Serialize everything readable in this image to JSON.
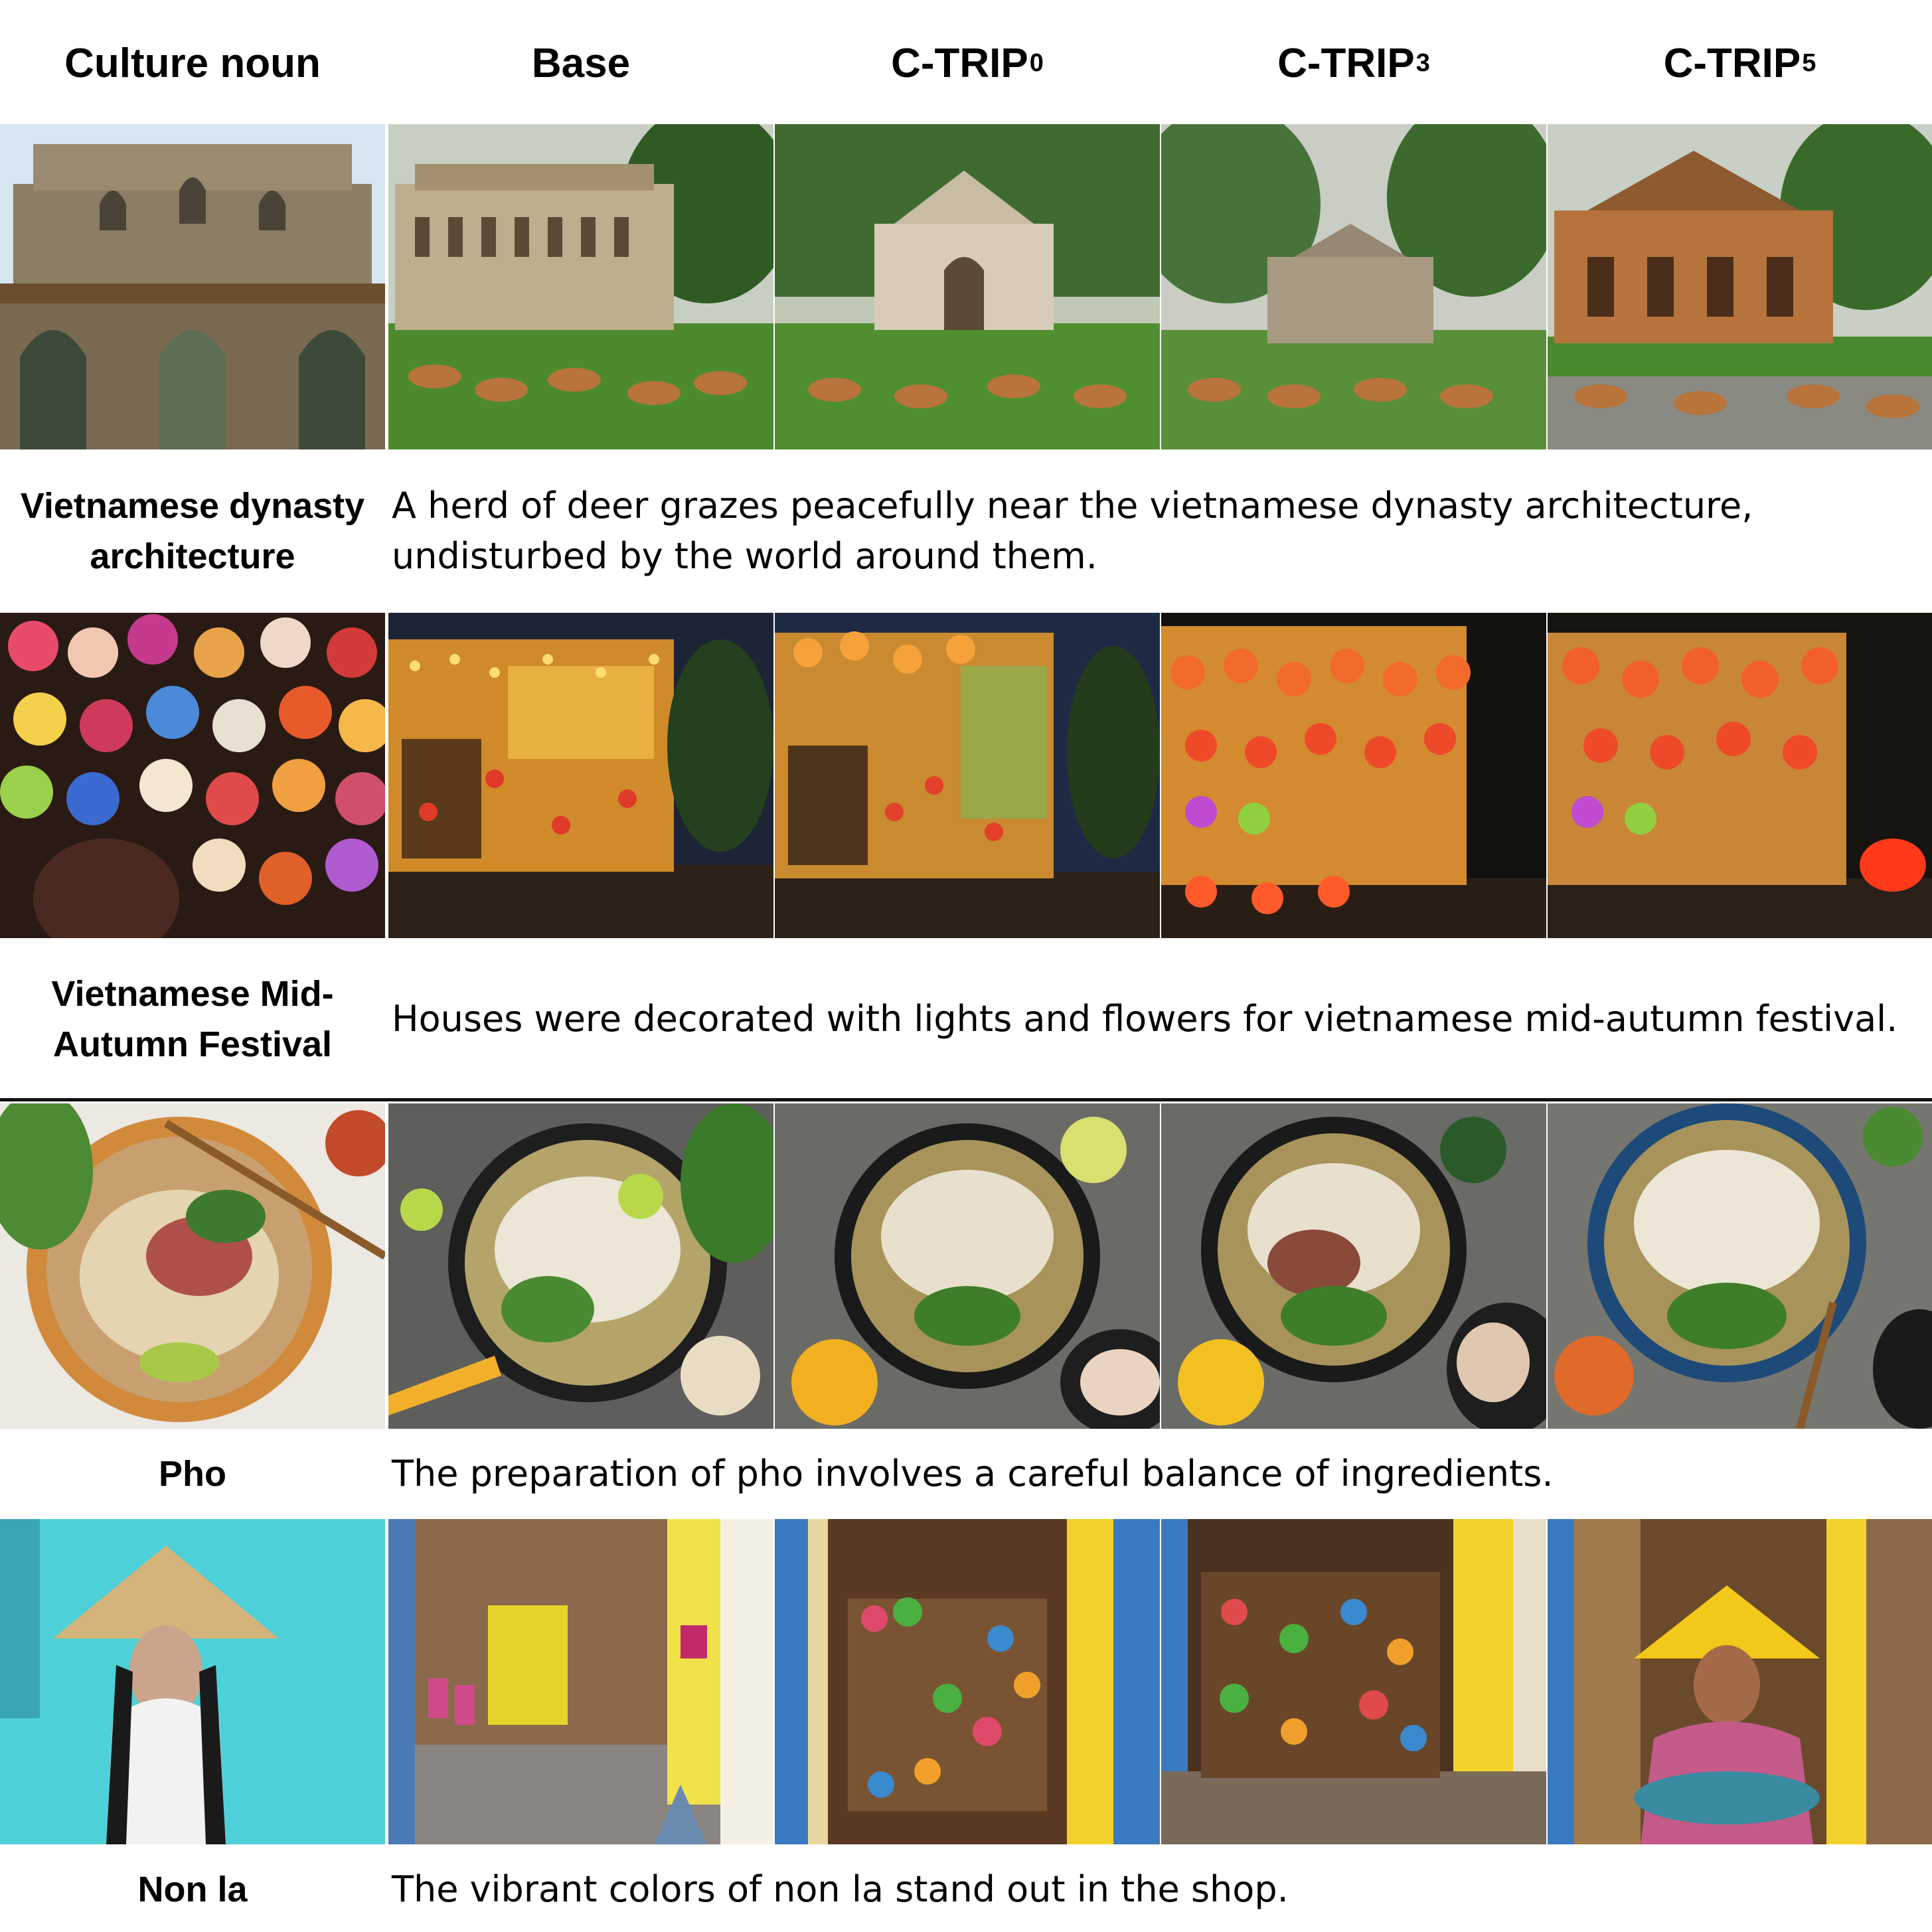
{
  "headers": {
    "col0": "Culture noun",
    "col1": "Base",
    "col2_main": "C-TRIP",
    "col2_sub": "0",
    "col3_main": "C-TRIP",
    "col3_sub": "3",
    "col4_main": "C-TRIP",
    "col4_sub": "5"
  },
  "rows": [
    {
      "noun": "Vietnamese dynasty architecture",
      "prompt": "A herd of deer grazes peacefully near the vietnamese dynasty architecture, undisturbed by the world around them."
    },
    {
      "noun": "Vietnamese Mid-Autumn Festival",
      "prompt": "Houses were decorated with lights and flowers for vietnamese mid-autumn festival."
    },
    {
      "noun": "Pho",
      "prompt": "The preparation of pho involves a careful balance of ingredients."
    },
    {
      "noun": "Non la",
      "prompt": "The vibrant colors of non la stand out in the shop."
    }
  ]
}
